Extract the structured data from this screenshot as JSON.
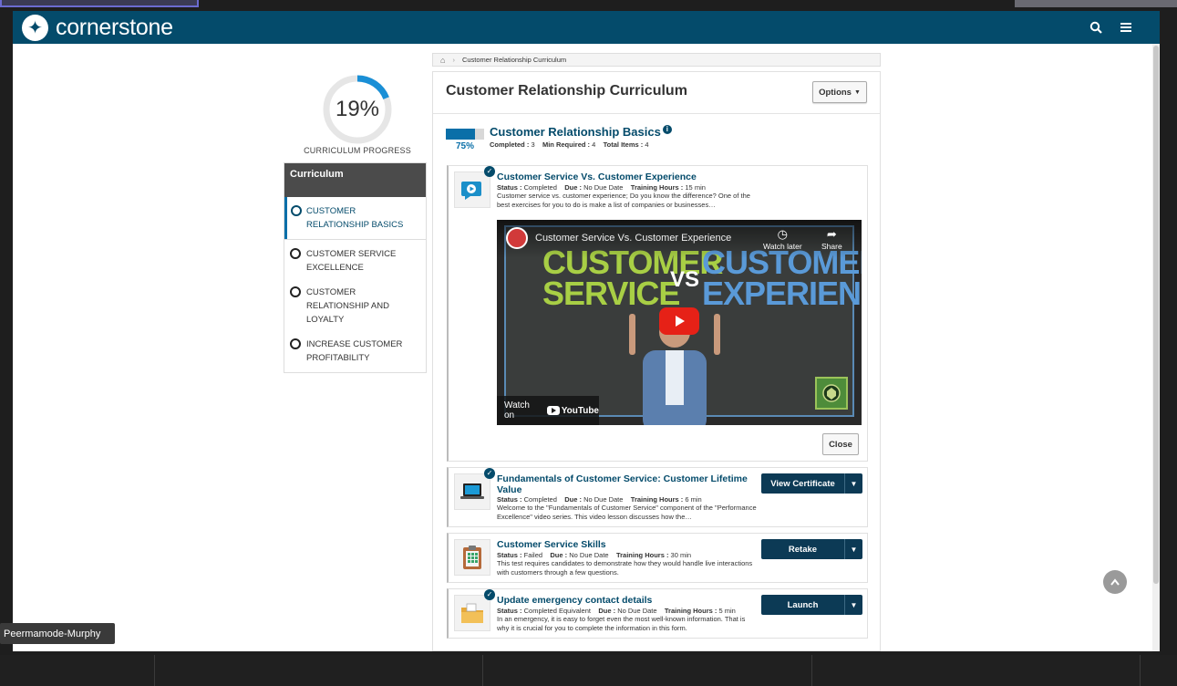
{
  "brand": {
    "name": "cornerstone"
  },
  "header": {
    "search_icon": "search-icon",
    "menu_icon": "hamburger-menu-icon"
  },
  "progress": {
    "percent": 19,
    "percent_label": "19%",
    "label": "CURRICULUM PROGRESS",
    "color": "#1a8fd6"
  },
  "sidebar": {
    "heading": "Curriculum",
    "items": [
      {
        "label": "CUSTOMER RELATIONSHIP BASICS",
        "active": true
      },
      {
        "label": "CUSTOMER SERVICE EXCELLENCE",
        "active": false
      },
      {
        "label": "CUSTOMER RELATIONSHIP AND LOYALTY",
        "active": false
      },
      {
        "label": "INCREASE CUSTOMER PROFITABILITY",
        "active": false
      }
    ]
  },
  "breadcrumb": {
    "current": "Customer Relationship Curriculum"
  },
  "main": {
    "title": "Customer Relationship Curriculum",
    "options_label": "Options",
    "section": {
      "title": "Customer Relationship Basics",
      "percent": 75,
      "percent_label": "75%",
      "completed_label": "Completed :",
      "completed": "3",
      "min_label": "Min Required :",
      "min": "4",
      "total_label": "Total Items :",
      "total": "4"
    },
    "items": [
      {
        "title": "Customer Service Vs. Customer Experience",
        "status_label": "Status :",
        "status": "Completed",
        "due_label": "Due :",
        "due": "No Due Date",
        "hours_label": "Training Hours :",
        "hours": "15 min",
        "desc": "Customer service vs. customer experience; Do you know the difference? One of the best exercises for you to do is make a list of companies or businesses…",
        "icon": "video-icon"
      },
      {
        "title": "Fundamentals of Customer Service: Customer Lifetime Value",
        "status_label": "Status :",
        "status": "Completed",
        "due_label": "Due :",
        "due": "No Due Date",
        "hours_label": "Training Hours :",
        "hours": "6 min",
        "desc": "Welcome to the \"Fundamentals of Customer Service\" component of the \"Performance Excellence\" video series. This video lesson discusses how the…",
        "action": "View Certificate",
        "icon": "laptop-icon"
      },
      {
        "title": "Customer Service Skills",
        "status_label": "Status :",
        "status": "Failed",
        "due_label": "Due :",
        "due": "No Due Date",
        "hours_label": "Training Hours :",
        "hours": "30 min",
        "desc": "This test requires candidates to demonstrate how they would handle live interactions with customers through a few questions.",
        "action": "Retake",
        "icon": "test-clipboard-icon"
      },
      {
        "title": "Update emergency contact details",
        "status_label": "Status :",
        "status": "Completed Equivalent",
        "due_label": "Due :",
        "due": "No Due Date",
        "hours_label": "Training Hours :",
        "hours": "5 min",
        "desc": "In an emergency, it is easy to forget even the most well-known information. That is why it is crucial for you to complete the information in this form.",
        "action": "Launch",
        "icon": "folder-icon"
      }
    ],
    "video": {
      "title": "Customer Service Vs. Customer Experience",
      "watch_later": "Watch later",
      "share": "Share",
      "watch_on": "Watch on",
      "youtube": "YouTube",
      "board_left": "CUSTOMER SERVICE",
      "board_vs": "VS",
      "board_right": "CUSTOMER EXPERIENCE"
    },
    "close_label": "Close"
  },
  "participant": {
    "name": "Peermamode-Murphy"
  }
}
